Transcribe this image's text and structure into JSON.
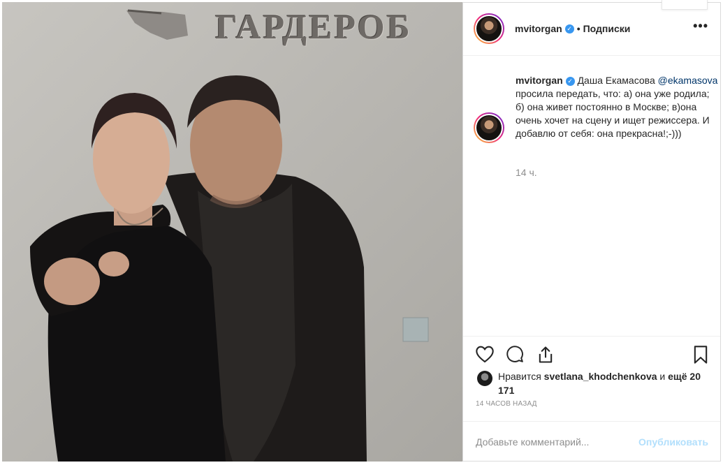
{
  "photo": {
    "sign_text": "ГАРДЕРОБ"
  },
  "post": {
    "username": "mvitorgan",
    "verified_icon": "check",
    "follow_label": "Подписки",
    "more_icon": "•••",
    "caption": {
      "username": "mvitorgan",
      "prefix": "Даша Екамасова",
      "mention": "@ekamasova",
      "body": "просила передать, что: а) она уже родила; б) она живет постоянно в Москве; в)она очень хочет на сцену и ищет режиссера. И добавлю от себя: она прекрасна!;-)))"
    },
    "caption_time": "14 ч.",
    "likes": {
      "prefix": "Нравится",
      "user": "svetlana_khodchenkova",
      "joiner": "и",
      "more": "ещё 20 171"
    },
    "post_time": "14 часов назад",
    "comment": {
      "placeholder": "Добавьте комментарий...",
      "publish_label": "Опубликовать"
    }
  },
  "colors": {
    "accent": "#3897f0",
    "publish_disabled": "#b2dffc",
    "muted": "#8e8e8e"
  }
}
